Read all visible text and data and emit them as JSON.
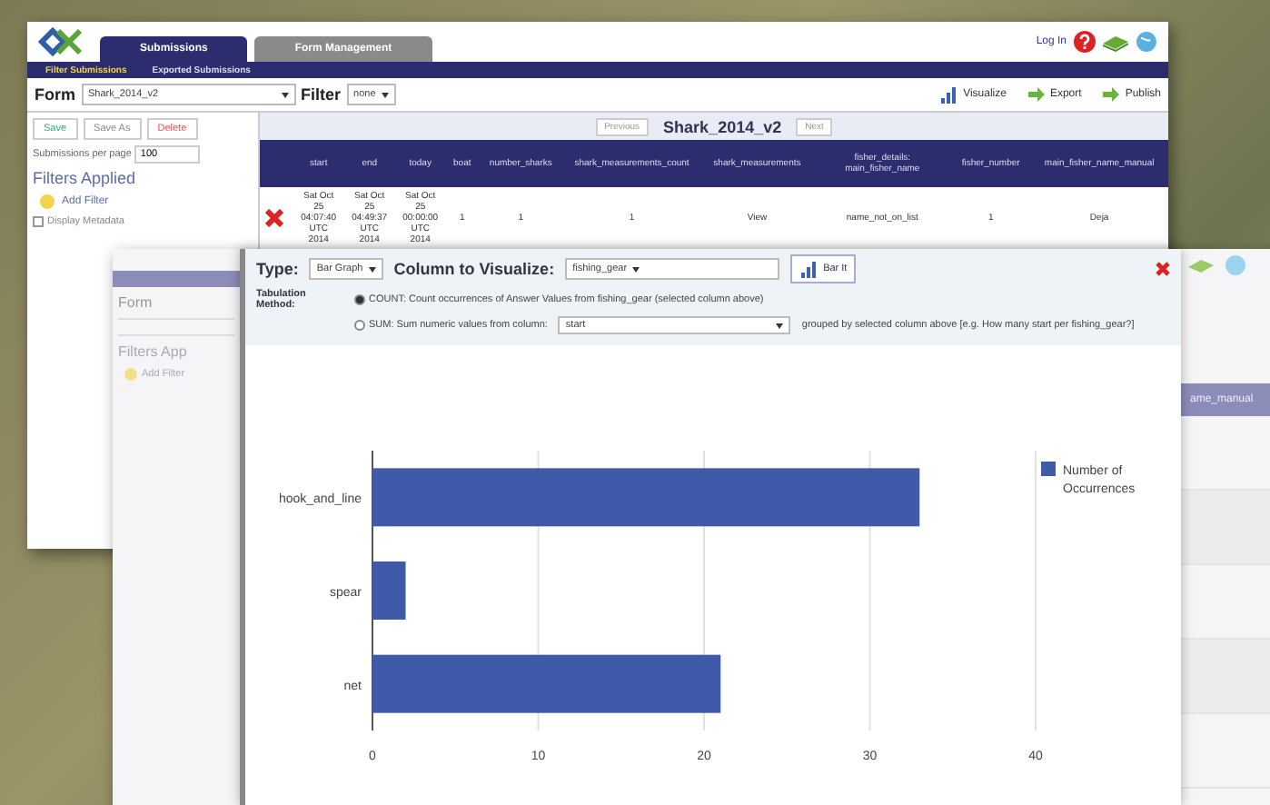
{
  "main_window": {
    "nav_tabs": [
      {
        "label": "Submissions",
        "selected": true
      },
      {
        "label": "Form Management",
        "selected": false
      }
    ],
    "sub_nav": [
      {
        "label": "Filter Submissions",
        "selected": true
      },
      {
        "label": "Exported Submissions",
        "selected": false
      }
    ],
    "login_link": "Log In",
    "form_select": {
      "label": "Form",
      "value": "Shark_2014_v2"
    },
    "filter_select": {
      "label": "Filter",
      "value": "none"
    },
    "toolbar": [
      "Visualize",
      "Export",
      "Publish"
    ],
    "side_buttons": [
      "Save",
      "Save As",
      "Delete"
    ],
    "per_page": {
      "label": "Submissions per page",
      "value": "100"
    },
    "filters_heading": "Filters Applied",
    "add_filter": "Add Filter",
    "display_metadata": {
      "label": "Display Metadata",
      "checked": false
    },
    "pager": {
      "previous": "Previous",
      "title": "Shark_2014_v2",
      "next": "Next"
    },
    "table": {
      "columns": [
        "start",
        "end",
        "today",
        "boat",
        "number_sharks",
        "shark_measurements_count",
        "shark_measurements",
        "fisher_details: main_fisher_name",
        "fisher_number",
        "main_fisher_name_manual"
      ],
      "rows": [
        {
          "cells": [
            "Sat Oct 25 04:07:40 UTC 2014",
            "Sat Oct 25 04:49:37 UTC 2014",
            "Sat Oct 25 00:00:00 UTC 2014",
            "1",
            "1",
            "1",
            "View",
            "name_not_on_list",
            "1",
            "Deja"
          ]
        }
      ]
    }
  },
  "back_window": {
    "form_label": "Form",
    "filters_heading": "Filters App",
    "add_filter": "Add Filter",
    "column_header": "ame_manual"
  },
  "visualize_dialog": {
    "type": {
      "label": "Type:",
      "value": "Bar Graph"
    },
    "column": {
      "label": "Column to Visualize:",
      "value": "fishing_gear"
    },
    "action_button": "Bar It",
    "tabulation_label": "Tabulation Method:",
    "tabulation_options": [
      {
        "text": "COUNT: Count occurrences of Answer Values from fishing_gear (selected column above)",
        "selected": true
      },
      {
        "text": "SUM: Sum numeric values from column:",
        "selected": false,
        "column": "start",
        "hint": "grouped by selected column above [e.g. How many start per fishing_gear?]"
      }
    ],
    "chart_data": {
      "type": "bar",
      "orientation": "horizontal",
      "categories": [
        "hook_and_line",
        "spear",
        "net"
      ],
      "series": [
        {
          "name": "Number of Occurrences",
          "color": "#3f5aa8",
          "values": [
            33,
            2,
            21
          ]
        }
      ],
      "grid": true,
      "xlim": [
        0,
        40
      ],
      "xticks": [
        0,
        10,
        20,
        30,
        40
      ]
    }
  }
}
